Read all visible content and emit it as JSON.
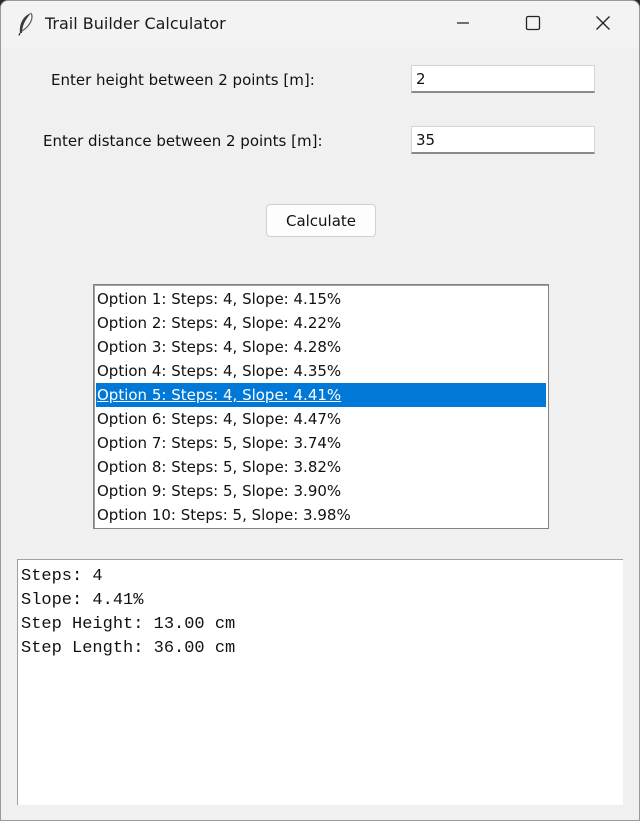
{
  "window": {
    "title": "Trail Builder Calculator",
    "icon": "feather-icon",
    "controls": [
      "minimize-icon",
      "maximize-icon",
      "close-icon"
    ]
  },
  "form": {
    "height_label": "Enter height between 2 points [m]:",
    "height_value": "2",
    "distance_label": "Enter distance between 2 points [m]:",
    "distance_value": "35",
    "calculate_label": "Calculate"
  },
  "options": {
    "selected_index": 4,
    "items": [
      "Option 1: Steps: 4, Slope: 4.15%",
      "Option 2: Steps: 4, Slope: 4.22%",
      "Option 3: Steps: 4, Slope: 4.28%",
      "Option 4: Steps: 4, Slope: 4.35%",
      "Option 5: Steps: 4, Slope: 4.41%",
      "Option 6: Steps: 4, Slope: 4.47%",
      "Option 7: Steps: 5, Slope: 3.74%",
      "Option 8: Steps: 5, Slope: 3.82%",
      "Option 9: Steps: 5, Slope: 3.90%",
      "Option 10: Steps: 5, Slope: 3.98%"
    ]
  },
  "output": {
    "lines": [
      "Steps: 4",
      "Slope: 4.41%",
      "Step Height: 13.00 cm",
      "Step Length: 36.00 cm"
    ]
  },
  "colors": {
    "selection": "#0078d7",
    "window_bg": "#f0f0f0"
  }
}
